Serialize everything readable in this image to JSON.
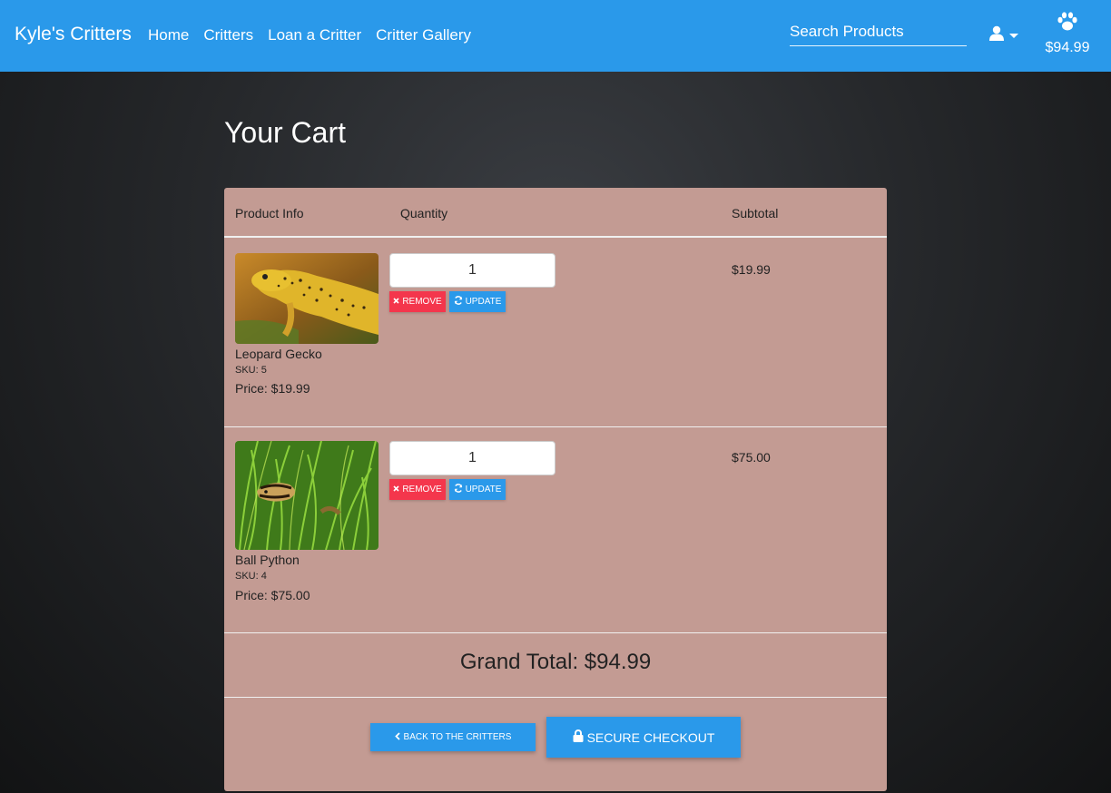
{
  "navbar": {
    "brand": "Kyle's Critters",
    "links": [
      "Home",
      "Critters",
      "Loan a Critter",
      "Critter Gallery"
    ],
    "search_placeholder": "Search Products",
    "cart_total": "$94.99",
    "color": "#2a99ea"
  },
  "page": {
    "title": "Your Cart"
  },
  "table": {
    "headers": {
      "product": "Product Info",
      "quantity": "Quantity",
      "subtotal": "Subtotal"
    }
  },
  "items": [
    {
      "name": "Leopard Gecko",
      "sku": "SKU: 5",
      "price": "Price: $19.99",
      "quantity": "1",
      "subtotal": "$19.99",
      "remove_label": "REMOVE",
      "update_label": "UPDATE"
    },
    {
      "name": "Ball Python",
      "sku": "SKU: 4",
      "price": "Price: $75.00",
      "quantity": "1",
      "subtotal": "$75.00",
      "remove_label": "REMOVE",
      "update_label": "UPDATE"
    }
  ],
  "grand_total": "Grand Total: $94.99",
  "actions": {
    "back_label": "BACK TO THE CRITTERS",
    "checkout_label": "SECURE CHECKOUT"
  },
  "icons": [
    "user-icon",
    "paw-icon",
    "times-icon",
    "refresh-icon",
    "chevron-left-icon",
    "lock-icon"
  ]
}
